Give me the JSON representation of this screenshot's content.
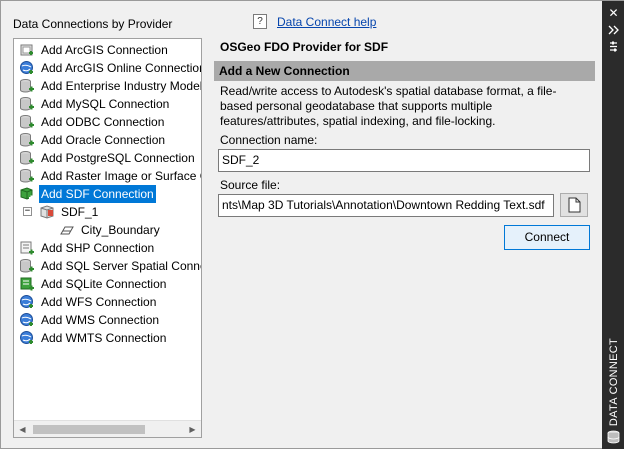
{
  "palette": {
    "title": "DATA CONNECT",
    "close_icon": "close-icon",
    "autohide_icon": "autohide-icon",
    "properties_icon": "properties-icon"
  },
  "left_panel": {
    "heading": "Data Connections by Provider",
    "tree": [
      {
        "label": "Add ArcGIS Connection",
        "icon": "arcgis-icon"
      },
      {
        "label": "Add ArcGIS Online Connection",
        "icon": "globe-icon"
      },
      {
        "label": "Add Enterprise Industry Model",
        "icon": "db-add-icon"
      },
      {
        "label": "Add MySQL Connection",
        "icon": "db-add-icon"
      },
      {
        "label": "Add ODBC Connection",
        "icon": "db-add-icon"
      },
      {
        "label": "Add Oracle Connection",
        "icon": "db-add-icon"
      },
      {
        "label": "Add PostgreSQL Connection",
        "icon": "db-add-icon"
      },
      {
        "label": "Add Raster Image or Surface C",
        "icon": "db-add-icon"
      },
      {
        "label": "Add SDF Connection",
        "icon": "sdf-add-icon",
        "selected": true
      },
      {
        "label": "SDF_1",
        "icon": "sdf-icon",
        "indent": 1
      },
      {
        "label": "City_Boundary",
        "icon": "feature-class-icon",
        "indent": 2
      },
      {
        "label": "Add SHP Connection",
        "icon": "shp-add-icon"
      },
      {
        "label": "Add SQL Server Spatial Connec",
        "icon": "db-add-icon"
      },
      {
        "label": "Add SQLite Connection",
        "icon": "sqlite-add-icon"
      },
      {
        "label": "Add WFS Connection",
        "icon": "globe-icon"
      },
      {
        "label": "Add WMS Connection",
        "icon": "globe-icon"
      },
      {
        "label": "Add WMTS Connection",
        "icon": "globe-icon"
      }
    ]
  },
  "right_panel": {
    "help_link": "Data Connect help",
    "provider_title": "OSGeo FDO Provider for SDF",
    "section_title": "Add a New Connection",
    "description_lines": [
      "Read/write access to Autodesk's spatial database format, a file-",
      "based personal geodatabase that supports multiple",
      "features/attributes, spatial indexing, and file-locking."
    ],
    "connection_name_label": "Connection name:",
    "connection_name_value": "SDF_2",
    "source_file_label": "Source file:",
    "source_file_value": "nts\\Map 3D Tutorials\\Annotation\\Downtown Redding Text.sdf",
    "connect_label": "Connect"
  },
  "colors": {
    "selection": "#0078d7",
    "palette_strip": "#2b2b2b",
    "section_bar": "#a9a9a9",
    "link": "#0645ad"
  }
}
